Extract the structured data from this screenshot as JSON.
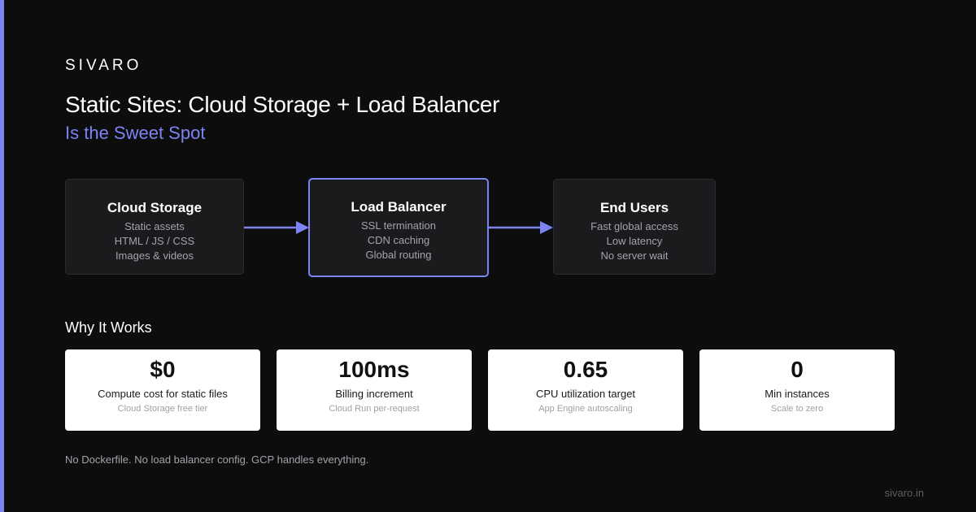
{
  "brand": "SIVARO",
  "title": "Static Sites: Cloud Storage + Load Balancer",
  "subtitle": "Is the Sweet Spot",
  "flow": {
    "nodes": [
      {
        "title": "Cloud Storage",
        "lines": [
          "Static assets",
          "HTML / JS / CSS",
          "Images & videos"
        ]
      },
      {
        "title": "Load Balancer",
        "lines": [
          "SSL termination",
          "CDN caching",
          "Global routing"
        ]
      },
      {
        "title": "End Users",
        "lines": [
          "Fast global access",
          "Low latency",
          "No server wait"
        ]
      }
    ]
  },
  "why": {
    "title": "Why It Works",
    "cards": [
      {
        "value": "$0",
        "label": "Compute cost for static files",
        "sub": "Cloud Storage free tier"
      },
      {
        "value": "100ms",
        "label": "Billing increment",
        "sub": "Cloud Run per-request"
      },
      {
        "value": "0.65",
        "label": "CPU utilization target",
        "sub": "App Engine autoscaling"
      },
      {
        "value": "0",
        "label": "Min instances",
        "sub": "Scale to zero"
      }
    ]
  },
  "footnote": "No Dockerfile. No load balancer config. GCP handles everything.",
  "site_url": "sivaro.in",
  "colors": {
    "accent": "#7c83f3",
    "background": "#0d0d0e",
    "node_background": "#1b1b1d"
  }
}
